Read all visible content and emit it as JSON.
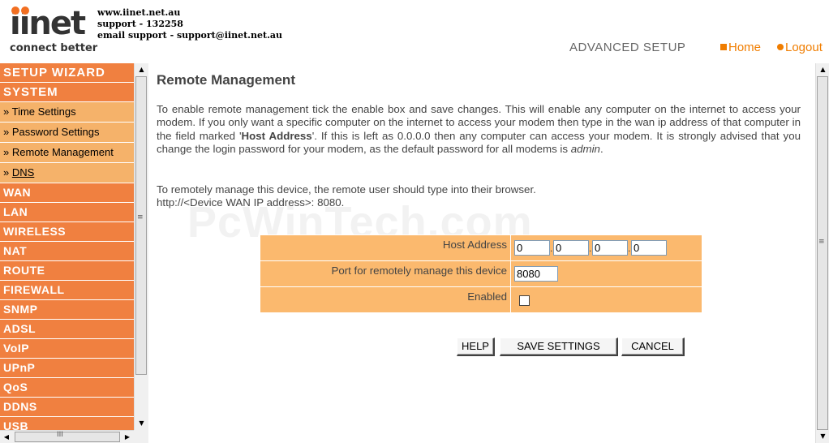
{
  "header": {
    "logo_text": "iinet",
    "logo_tagline": "connect better",
    "contact": {
      "website": "www.iinet.net.au",
      "support": "support - 132258",
      "email": "email support - support@iinet.net.au"
    },
    "section_title": "ADVANCED SETUP",
    "home_label": "Home",
    "logout_label": "Logout"
  },
  "colors": {
    "accent": "#f08040",
    "submenu": "#f5b26a",
    "form_bg": "#fbb96e",
    "link": "#f07d00"
  },
  "sidebar": {
    "items": [
      {
        "label": "SETUP WIZARD",
        "type": "main"
      },
      {
        "label": "SYSTEM",
        "type": "main"
      },
      {
        "label": "» Time Settings",
        "type": "sub"
      },
      {
        "label": "» Password Settings",
        "type": "sub"
      },
      {
        "label": "» Remote Management",
        "type": "sub"
      },
      {
        "label_prefix": "» ",
        "label": "DNS",
        "type": "sub"
      },
      {
        "label": "WAN",
        "type": "main"
      },
      {
        "label": "LAN",
        "type": "main"
      },
      {
        "label": "WIRELESS",
        "type": "main"
      },
      {
        "label": "NAT",
        "type": "main"
      },
      {
        "label": "ROUTE",
        "type": "main"
      },
      {
        "label": "FIREWALL",
        "type": "main"
      },
      {
        "label": "SNMP",
        "type": "main"
      },
      {
        "label": "ADSL",
        "type": "main"
      },
      {
        "label": "VoIP",
        "type": "main"
      },
      {
        "label": "UPnP",
        "type": "main"
      },
      {
        "label": "QoS",
        "type": "main"
      },
      {
        "label": "DDNS",
        "type": "main"
      },
      {
        "label": "USB",
        "type": "main"
      }
    ]
  },
  "main": {
    "watermark": "PcWinTech.com",
    "title": "Remote Management",
    "desc_part1": "To enable remote management tick the enable box and save changes. This will enable any computer on the internet to access your modem. If you only want a specific computer on the internet to access your modem then type in the wan ip address of that computer in the field marked '",
    "desc_bold": "Host Address",
    "desc_part2": "'. If this is left as 0.0.0.0 then any computer can access your modem. It is strongly advised that you change the login password for your modem, as the default password for all modems is ",
    "desc_italic": "admin",
    "desc_end": ".",
    "desc2_line1": "To remotely manage this device, the remote user should type into their browser.",
    "desc2_line2": "http://<Device WAN IP address>: 8080.",
    "form": {
      "host_label": "Host Address",
      "host_octets": [
        "0",
        "0",
        "0",
        "0"
      ],
      "port_label": "Port for remotely manage this device",
      "port_value": "8080",
      "enabled_label": "Enabled",
      "enabled_checked": false
    },
    "buttons": {
      "help": "HELP",
      "save": "SAVE SETTINGS",
      "cancel": "CANCEL"
    }
  },
  "icons": {
    "scroll_up": "▲",
    "scroll_down": "▼",
    "scroll_left": "◀",
    "scroll_right": "▶",
    "grip": "≡",
    "hgrip": "III"
  }
}
